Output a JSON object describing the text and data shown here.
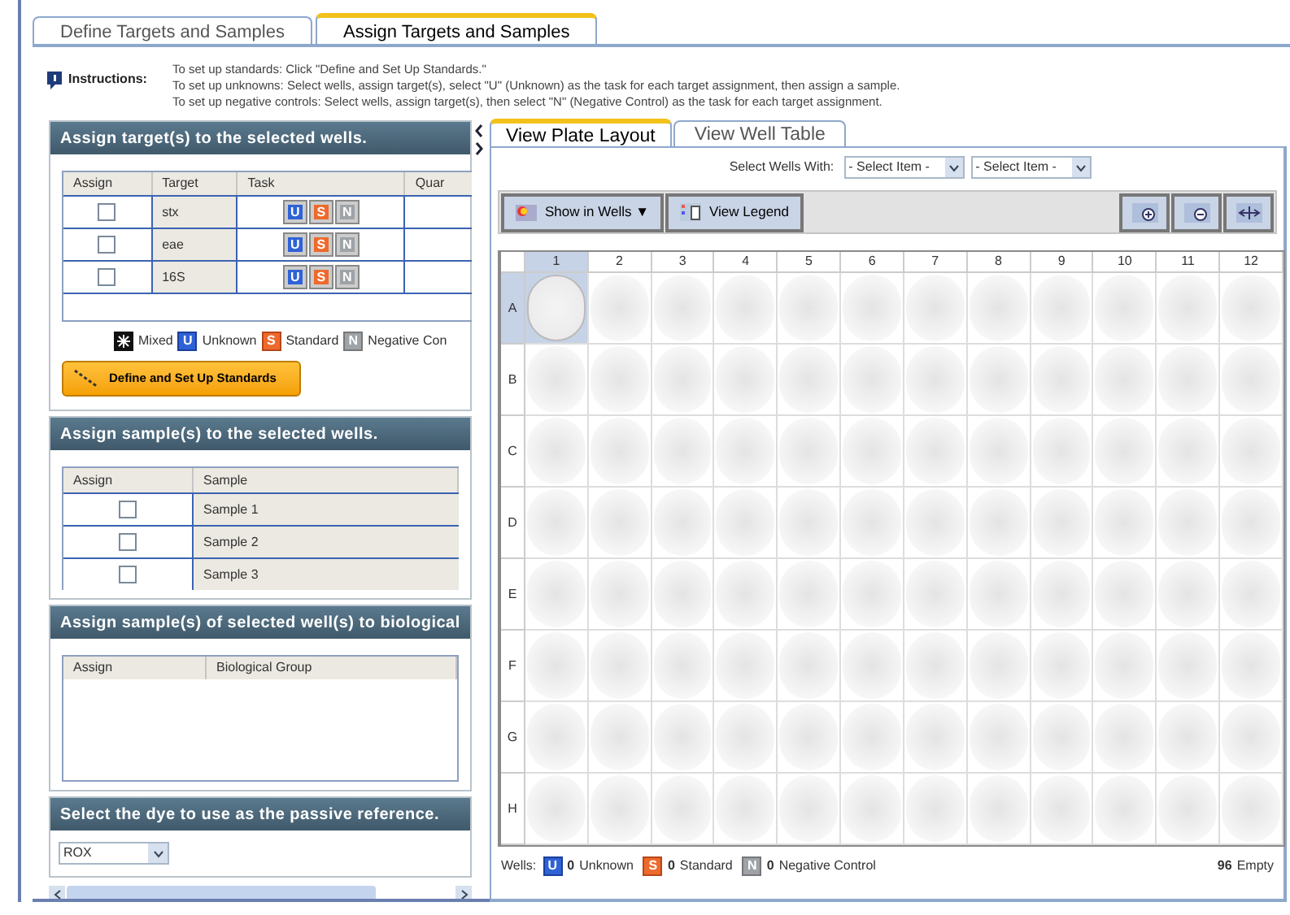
{
  "main_tabs": [
    {
      "label": "Define Targets and Samples",
      "selected": false
    },
    {
      "label": "Assign Targets and Samples",
      "selected": true
    }
  ],
  "instructions": {
    "label": "Instructions:",
    "lines": [
      "To set up standards: Click \"Define and Set Up Standards.\"",
      "To set up unknowns: Select wells, assign target(s), select \"U\" (Unknown) as the task for each target assignment, then assign a sample.",
      "To set up negative controls: Select wells, assign target(s), then select \"N\" (Negative Control) as the task for each target assignment."
    ]
  },
  "targets_panel": {
    "title": "Assign target(s) to the selected wells.",
    "columns": [
      "Assign",
      "Target",
      "Task",
      "Quar"
    ],
    "rows": [
      {
        "checked": false,
        "target": "stx",
        "tasks": [
          "U",
          "S",
          "N"
        ]
      },
      {
        "checked": false,
        "target": "eae",
        "tasks": [
          "U",
          "S",
          "N"
        ]
      },
      {
        "checked": false,
        "target": "16S",
        "tasks": [
          "U",
          "S",
          "N"
        ]
      }
    ],
    "legend": [
      {
        "kind": "mixed",
        "label": "Mixed"
      },
      {
        "kind": "unknown",
        "badge": "U",
        "label": "Unknown"
      },
      {
        "kind": "standard",
        "badge": "S",
        "label": "Standard"
      },
      {
        "kind": "negative",
        "badge": "N",
        "label": "Negative Con"
      }
    ],
    "button": "Define and Set Up Standards"
  },
  "samples_panel": {
    "title": "Assign sample(s) to the selected wells.",
    "columns": [
      "Assign",
      "Sample"
    ],
    "rows": [
      {
        "checked": false,
        "sample": "Sample 1"
      },
      {
        "checked": false,
        "sample": "Sample 2"
      },
      {
        "checked": false,
        "sample": "Sample 3"
      }
    ]
  },
  "groups_panel": {
    "title": "Assign sample(s) of selected well(s) to biological",
    "columns": [
      "Assign",
      "Biological Group"
    ]
  },
  "dye_panel": {
    "title": "Select the dye to use as the passive reference.",
    "value": "ROX"
  },
  "view_tabs": [
    {
      "label": "View Plate Layout",
      "selected": true
    },
    {
      "label": "View Well Table",
      "selected": false
    }
  ],
  "select_wells": {
    "label": "Select Wells With:",
    "dropdowns": [
      "- Select Item -",
      "- Select Item -"
    ]
  },
  "toolbar": {
    "show_in_wells": "Show in Wells ▼",
    "view_legend": "View Legend"
  },
  "plate": {
    "columns": [
      "1",
      "2",
      "3",
      "4",
      "5",
      "6",
      "7",
      "8",
      "9",
      "10",
      "11",
      "12"
    ],
    "rows": [
      {
        "label": "A",
        "wells": [
          {
            "selected": true
          },
          {
            "selected": false
          },
          {
            "selected": false
          },
          {
            "selected": false
          },
          {
            "selected": false
          },
          {
            "selected": false
          },
          {
            "selected": false
          },
          {
            "selected": false
          },
          {
            "selected": false
          },
          {
            "selected": false
          },
          {
            "selected": false
          },
          {
            "selected": false
          }
        ]
      },
      {
        "label": "B",
        "wells": [
          {
            "selected": false
          },
          {
            "selected": false
          },
          {
            "selected": false
          },
          {
            "selected": false
          },
          {
            "selected": false
          },
          {
            "selected": false
          },
          {
            "selected": false
          },
          {
            "selected": false
          },
          {
            "selected": false
          },
          {
            "selected": false
          },
          {
            "selected": false
          },
          {
            "selected": false
          }
        ]
      },
      {
        "label": "C",
        "wells": [
          {
            "selected": false
          },
          {
            "selected": false
          },
          {
            "selected": false
          },
          {
            "selected": false
          },
          {
            "selected": false
          },
          {
            "selected": false
          },
          {
            "selected": false
          },
          {
            "selected": false
          },
          {
            "selected": false
          },
          {
            "selected": false
          },
          {
            "selected": false
          },
          {
            "selected": false
          }
        ]
      },
      {
        "label": "D",
        "wells": [
          {
            "selected": false
          },
          {
            "selected": false
          },
          {
            "selected": false
          },
          {
            "selected": false
          },
          {
            "selected": false
          },
          {
            "selected": false
          },
          {
            "selected": false
          },
          {
            "selected": false
          },
          {
            "selected": false
          },
          {
            "selected": false
          },
          {
            "selected": false
          },
          {
            "selected": false
          }
        ]
      },
      {
        "label": "E",
        "wells": [
          {
            "selected": false
          },
          {
            "selected": false
          },
          {
            "selected": false
          },
          {
            "selected": false
          },
          {
            "selected": false
          },
          {
            "selected": false
          },
          {
            "selected": false
          },
          {
            "selected": false
          },
          {
            "selected": false
          },
          {
            "selected": false
          },
          {
            "selected": false
          },
          {
            "selected": false
          }
        ]
      },
      {
        "label": "F",
        "wells": [
          {
            "selected": false
          },
          {
            "selected": false
          },
          {
            "selected": false
          },
          {
            "selected": false
          },
          {
            "selected": false
          },
          {
            "selected": false
          },
          {
            "selected": false
          },
          {
            "selected": false
          },
          {
            "selected": false
          },
          {
            "selected": false
          },
          {
            "selected": false
          },
          {
            "selected": false
          }
        ]
      },
      {
        "label": "G",
        "wells": [
          {
            "selected": false
          },
          {
            "selected": false
          },
          {
            "selected": false
          },
          {
            "selected": false
          },
          {
            "selected": false
          },
          {
            "selected": false
          },
          {
            "selected": false
          },
          {
            "selected": false
          },
          {
            "selected": false
          },
          {
            "selected": false
          },
          {
            "selected": false
          },
          {
            "selected": false
          }
        ]
      },
      {
        "label": "H",
        "wells": [
          {
            "selected": false
          },
          {
            "selected": false
          },
          {
            "selected": false
          },
          {
            "selected": false
          },
          {
            "selected": false
          },
          {
            "selected": false
          },
          {
            "selected": false
          },
          {
            "selected": false
          },
          {
            "selected": false
          },
          {
            "selected": false
          },
          {
            "selected": false
          },
          {
            "selected": false
          }
        ]
      }
    ]
  },
  "footer": {
    "label": "Wells:",
    "counts": [
      {
        "kind": "unknown",
        "badge": "U",
        "count": "0",
        "label": "Unknown"
      },
      {
        "kind": "standard",
        "badge": "S",
        "count": "0",
        "label": "Standard"
      },
      {
        "kind": "negative",
        "badge": "N",
        "count": "0",
        "label": "Negative Control"
      }
    ],
    "empty_count": "96",
    "empty_label": "Empty"
  }
}
